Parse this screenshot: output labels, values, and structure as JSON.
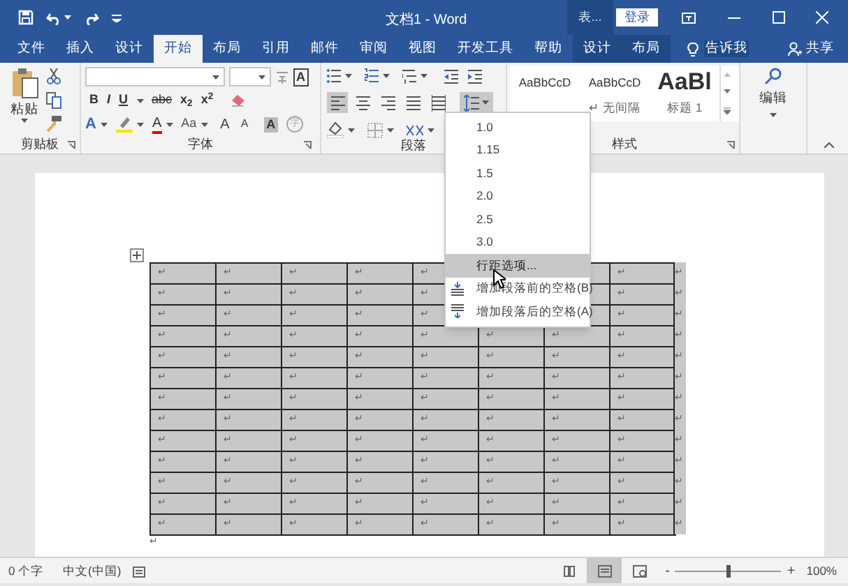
{
  "window": {
    "title": "文档1 - Word",
    "contextual_group": "表...",
    "sign_in": "登录"
  },
  "tabs": [
    {
      "label": "文件",
      "selected": false,
      "kind": "normal"
    },
    {
      "label": "插入",
      "selected": false,
      "kind": "normal"
    },
    {
      "label": "设计",
      "selected": false,
      "kind": "normal"
    },
    {
      "label": "开始",
      "selected": true,
      "kind": "normal"
    },
    {
      "label": "布局",
      "selected": false,
      "kind": "normal"
    },
    {
      "label": "引用",
      "selected": false,
      "kind": "normal"
    },
    {
      "label": "邮件",
      "selected": false,
      "kind": "normal"
    },
    {
      "label": "审阅",
      "selected": false,
      "kind": "normal"
    },
    {
      "label": "视图",
      "selected": false,
      "kind": "normal"
    },
    {
      "label": "开发工具",
      "selected": false,
      "kind": "normal"
    },
    {
      "label": "帮助",
      "selected": false,
      "kind": "normal"
    },
    {
      "label": "设计",
      "selected": false,
      "kind": "contextual"
    },
    {
      "label": "布局",
      "selected": false,
      "kind": "contextual"
    }
  ],
  "tell_me": "告诉我",
  "share": "共享",
  "ribbon": {
    "clipboard": {
      "paste": "粘贴",
      "label": "剪贴板"
    },
    "font": {
      "label": "字体",
      "format_buttons": [
        "B",
        "I",
        "U",
        "abc",
        "x$_{2}$",
        "x$^{2}$"
      ],
      "text_effect": "A",
      "font_color": "A",
      "change_case": "Aa",
      "grow": "A",
      "shrink": "A",
      "shading": "A",
      "enclose": "字",
      "char_border": "A"
    },
    "paragraph": {
      "label": "段落",
      "alignments": [
        {
          "kind": "left",
          "selected": true
        },
        {
          "kind": "center",
          "selected": false
        },
        {
          "kind": "right",
          "selected": false
        },
        {
          "kind": "justify",
          "selected": false
        },
        {
          "kind": "distributed",
          "selected": false
        }
      ],
      "line_spacing_open": true
    },
    "styles": {
      "label": "样式",
      "items": [
        {
          "preview": "AaBbCcD"
        },
        {
          "preview": "AaBbCcD",
          "name": "↵ 无间隔"
        },
        {
          "preview": "AaBl",
          "name": "标题 1"
        }
      ]
    },
    "editing": {
      "label": "编辑"
    }
  },
  "line_spacing_menu": {
    "items": [
      {
        "label": "1.0",
        "kind": "value",
        "selected": false
      },
      {
        "label": "1.15",
        "kind": "value",
        "selected": false
      },
      {
        "label": "1.5",
        "kind": "value",
        "selected": false
      },
      {
        "label": "2.0",
        "kind": "value",
        "selected": false
      },
      {
        "label": "2.5",
        "kind": "value",
        "selected": false
      },
      {
        "label": "3.0",
        "kind": "value",
        "selected": false
      },
      {
        "label": "行距选项...",
        "kind": "options",
        "selected": true
      },
      {
        "label": "增加段落前的空格(B)",
        "kind": "space_before",
        "selected": false
      },
      {
        "label": "增加段落后的空格(A)",
        "kind": "space_after",
        "selected": false
      }
    ]
  },
  "table": {
    "rows": [
      {
        "cells": [
          "↵",
          "↵",
          "↵",
          "↵",
          "↵",
          null,
          null,
          "↵"
        ],
        "end": "↵"
      },
      {
        "cells": [
          "↵",
          "↵",
          "↵",
          "↵",
          "↵",
          null,
          null,
          "↵"
        ],
        "end": "↵"
      },
      {
        "cells": [
          "↵",
          "↵",
          "↵",
          "↵",
          "↵",
          null,
          null,
          "↵"
        ],
        "end": "↵"
      },
      {
        "cells": [
          "↵",
          "↵",
          "↵",
          "↵",
          "↵",
          "↵",
          "↵",
          "↵"
        ],
        "end": "↵"
      },
      {
        "cells": [
          "↵",
          "↵",
          "↵",
          "↵",
          "↵",
          "↵",
          "↵",
          "↵"
        ],
        "end": "↵"
      },
      {
        "cells": [
          "↵",
          "↵",
          "↵",
          "↵",
          "↵",
          "↵",
          "↵",
          "↵"
        ],
        "end": "↵"
      },
      {
        "cells": [
          "↵",
          "↵",
          "↵",
          "↵",
          "↵",
          "↵",
          "↵",
          "↵"
        ],
        "end": "↵"
      },
      {
        "cells": [
          "↵",
          "↵",
          "↵",
          "↵",
          "↵",
          "↵",
          "↵",
          "↵"
        ],
        "end": "↵"
      },
      {
        "cells": [
          "↵",
          "↵",
          "↵",
          "↵",
          "↵",
          "↵",
          "↵",
          "↵"
        ],
        "end": "↵"
      },
      {
        "cells": [
          "↵",
          "↵",
          "↵",
          "↵",
          "↵",
          "↵",
          "↵",
          "↵"
        ],
        "end": "↵"
      },
      {
        "cells": [
          "↵",
          "↵",
          "↵",
          "↵",
          "↵",
          "↵",
          "↵",
          "↵"
        ],
        "end": "↵"
      },
      {
        "cells": [
          "↵",
          "↵",
          "↵",
          "↵",
          "↵",
          "↵",
          "↵",
          "↵"
        ],
        "end": "↵"
      },
      {
        "cells": [
          "↵",
          "↵",
          "↵",
          "↵",
          "↵",
          "↵",
          "↵",
          "↵"
        ],
        "end": "↵"
      }
    ],
    "after": "↵"
  },
  "status_bar": {
    "word_count": "0 个字",
    "language": "中文(中国)",
    "views": [
      {
        "kind": "read",
        "selected": false
      },
      {
        "kind": "print",
        "selected": true
      },
      {
        "kind": "web",
        "selected": false
      }
    ],
    "zoom_out": "-",
    "zoom_in": "+",
    "zoom": {
      "level": 0.5
    },
    "zoom_percent": "100%"
  }
}
